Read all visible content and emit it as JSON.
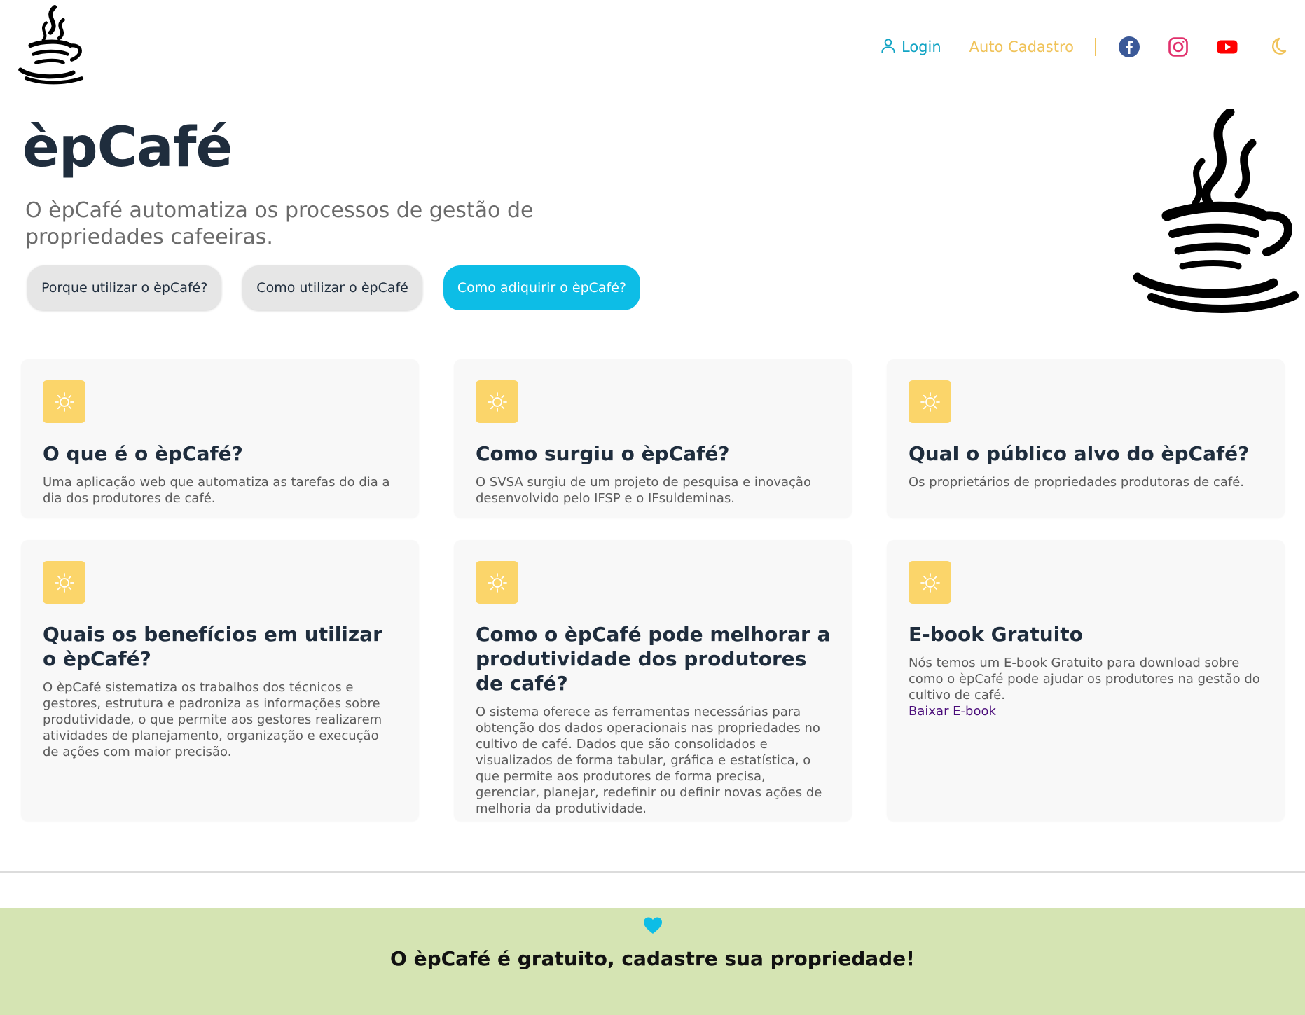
{
  "header": {
    "logo_icon": "coffee-cup-icon",
    "nav": {
      "login_label": "Login",
      "login_icon": "user-icon",
      "cadastro_label": "Auto Cadastro"
    },
    "social": [
      {
        "name": "facebook-icon",
        "color": "#3b5998"
      },
      {
        "name": "instagram-icon",
        "color": "#e1306c"
      },
      {
        "name": "youtube-icon",
        "color": "#ff0000"
      }
    ],
    "theme_toggle_icon": "moon-icon"
  },
  "hero": {
    "title": "èpCafé",
    "subtitle": "O èpCafé automatiza os processos de gestão de propriedades cafeeiras.",
    "buttons": [
      {
        "label": "Porque utilizar o èpCafé?",
        "style": "light"
      },
      {
        "label": "Como utilizar o èpCafé",
        "style": "light"
      },
      {
        "label": "Como adiquirir o èpCafé?",
        "style": "primary"
      }
    ],
    "image_icon": "coffee-cup-icon"
  },
  "features": [
    {
      "icon": "sun-icon",
      "title": "O que é o èpCafé?",
      "text": "Uma aplicação web que automatiza as tarefas do dia a dia dos produtores de café."
    },
    {
      "icon": "sun-icon",
      "title": "Como surgiu o èpCafé?",
      "text": "O SVSA surgiu de um projeto de pesquisa e inovação desenvolvido pelo IFSP e o IFsuldeminas."
    },
    {
      "icon": "sun-icon",
      "title": "Qual o público alvo do èpCafé?",
      "text": "Os proprietários de propriedades produtoras de café."
    },
    {
      "icon": "sun-icon",
      "title": "Quais os benefícios em utilizar o èpCafé?",
      "text": "O èpCafé sistematiza os trabalhos dos técnicos e gestores, estrutura e padroniza as informações sobre produtividade, o que permite aos gestores realizarem atividades de planejamento, organização e execução de ações com maior precisão."
    },
    {
      "icon": "sun-icon",
      "title": "Como o èpCafé pode melhorar a produtividade dos produtores de café?",
      "text": "O sistema oferece as ferramentas necessárias para obtenção dos dados operacionais nas propriedades no cultivo de café. Dados que são consolidados e visualizados de forma tabular, gráfica e estatística, o que permite aos produtores de forma precisa, gerenciar, planejar, redefinir ou definir novas ações de melhoria da produtividade."
    },
    {
      "icon": "sun-icon",
      "title": "E-book Gratuito",
      "text": "Nós temos um E-book Gratuito para download sobre como o èpCafé pode ajudar os produtores na gestão do cultivo de café.",
      "link": "Baixar E-book"
    }
  ],
  "cta": {
    "icon": "heart-icon",
    "text": "O èpCafé é gratuito, cadastre sua propriedade!"
  },
  "colors": {
    "accent": "#0dbde6",
    "login": "#12a4c4",
    "cadastro": "#f0c35a",
    "icon_bg": "#fbd56a",
    "cta_bg": "#d5e4b3",
    "title": "#1f2d3d"
  }
}
